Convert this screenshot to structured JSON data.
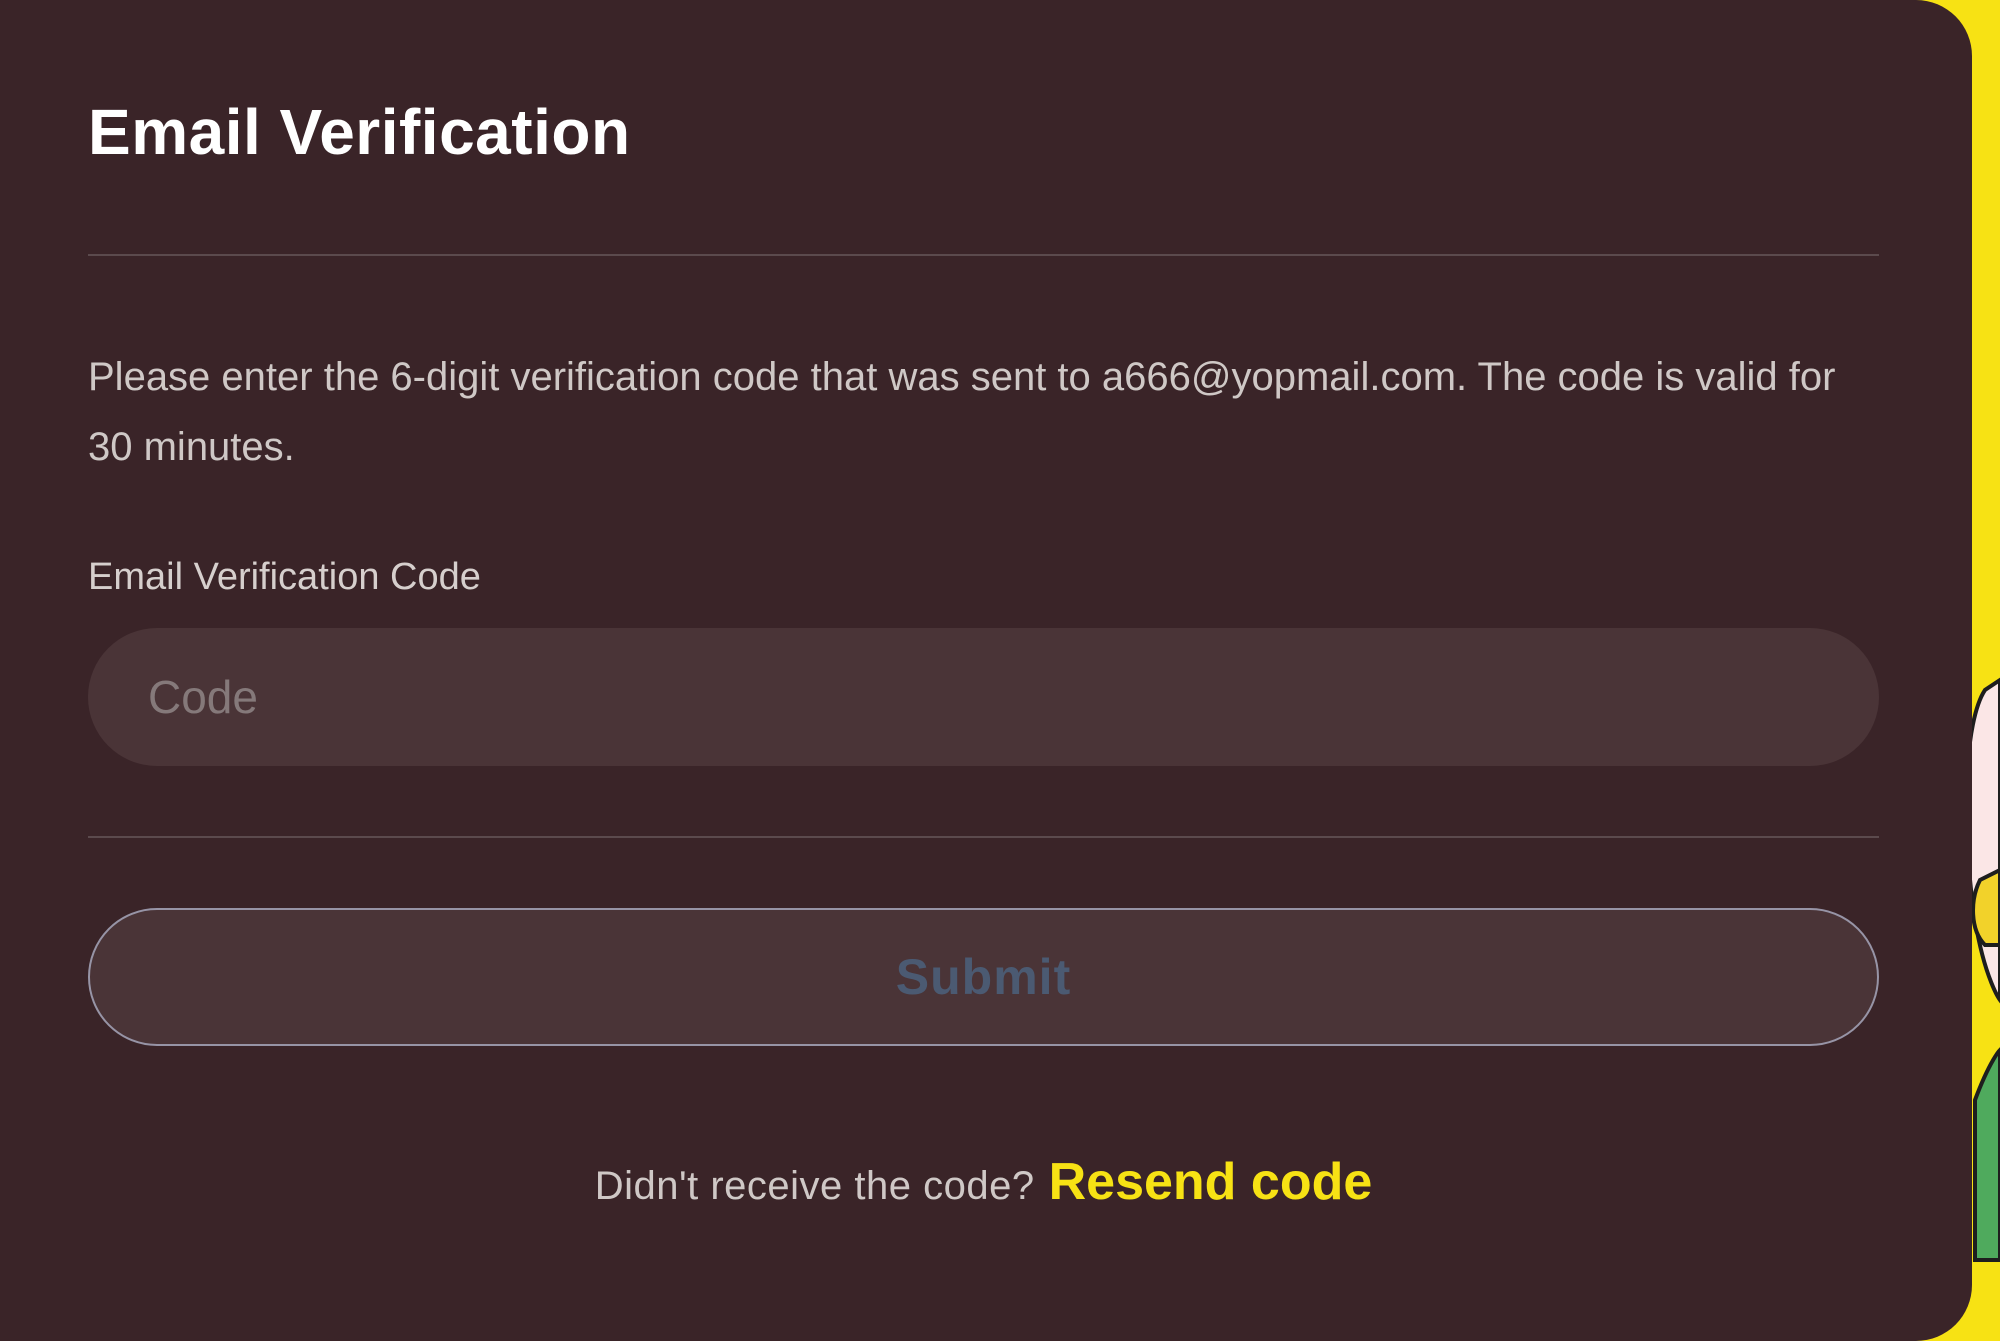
{
  "modal": {
    "title": "Email Verification",
    "description": "Please enter the 6-digit verification code that was sent to a666@yopmail.com. The code is valid for 30 minutes.",
    "code_field": {
      "label": "Email Verification Code",
      "placeholder": "Code",
      "value": ""
    },
    "submit_label": "Submit",
    "resend": {
      "prompt": "Didn't receive the code?",
      "link_label": "Resend code"
    }
  },
  "colors": {
    "page_background": "#f7e214",
    "modal_background": "#3a2428",
    "input_background": "#4a3437",
    "accent": "#f7e214",
    "submit_text_disabled": "#4b5a72"
  }
}
